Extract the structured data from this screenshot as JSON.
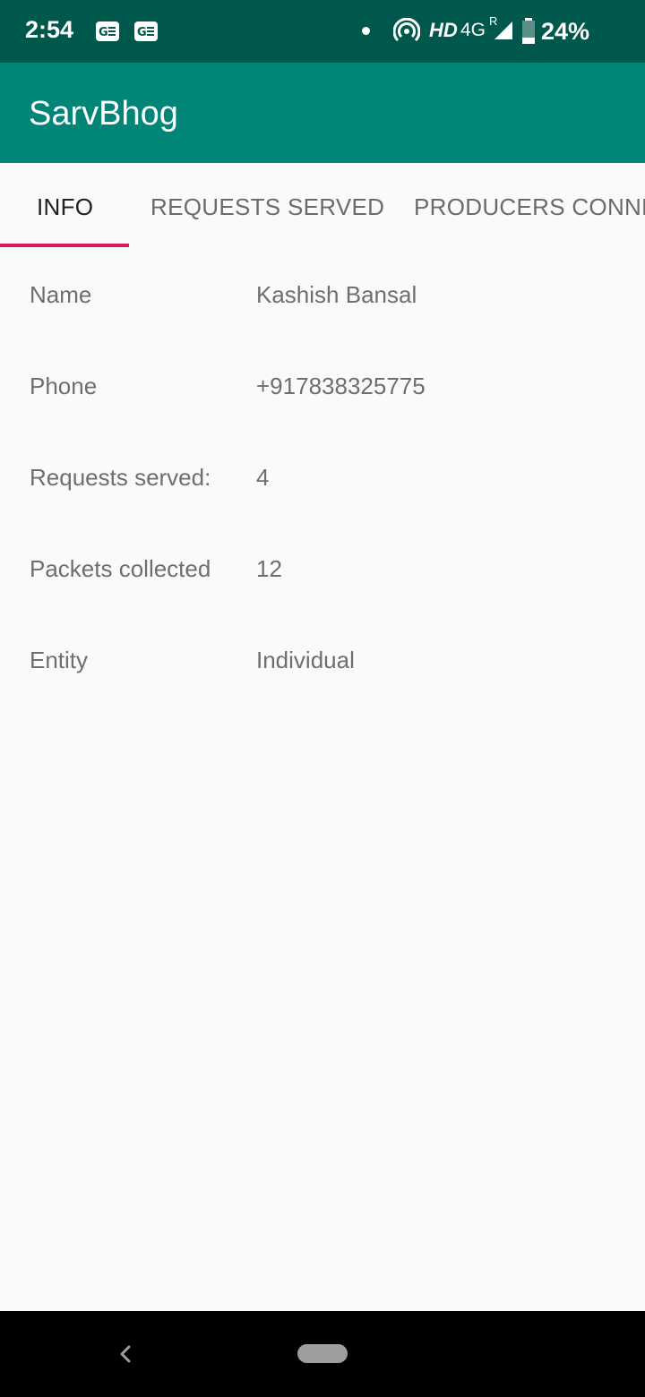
{
  "status_bar": {
    "time": "2:54",
    "notification_icons": [
      "ge-notification-icon",
      "ge-notification-icon"
    ],
    "hd_label": "HD",
    "network_label": "4G",
    "roaming_label": "R",
    "battery_percent": "24%",
    "battery_level": 0.24
  },
  "app_bar": {
    "title": "SarvBhog"
  },
  "tabs": [
    {
      "label": "INFO",
      "active": true
    },
    {
      "label": "REQUESTS SERVED",
      "active": false
    },
    {
      "label": "PRODUCERS CONNECTED",
      "active": false
    }
  ],
  "info": [
    {
      "label": "Name",
      "value": "Kashish Bansal"
    },
    {
      "label": "Phone",
      "value": "+917838325775"
    },
    {
      "label": "Requests served:",
      "value": "4"
    },
    {
      "label": "Packets collected",
      "value": "12"
    },
    {
      "label": "Entity",
      "value": "Individual"
    }
  ],
  "colors": {
    "status_bar": "#00574b",
    "app_bar": "#008577",
    "tab_indicator": "#d81b60",
    "background": "#fafafa"
  }
}
